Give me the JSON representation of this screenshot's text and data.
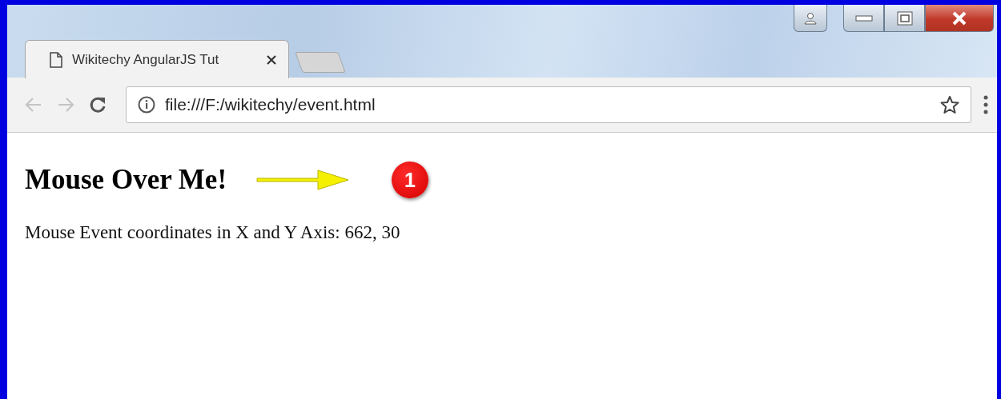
{
  "tab": {
    "title": "Wikitechy AngularJS Tut",
    "selected": true
  },
  "address_bar": {
    "value": "file:///F:/wikitechy/event.html"
  },
  "page": {
    "heading": "Mouse Over Me!",
    "paragraph": "Mouse Event coordinates in X and Y Axis: 662, 30"
  },
  "annotation": {
    "badge": "1"
  }
}
